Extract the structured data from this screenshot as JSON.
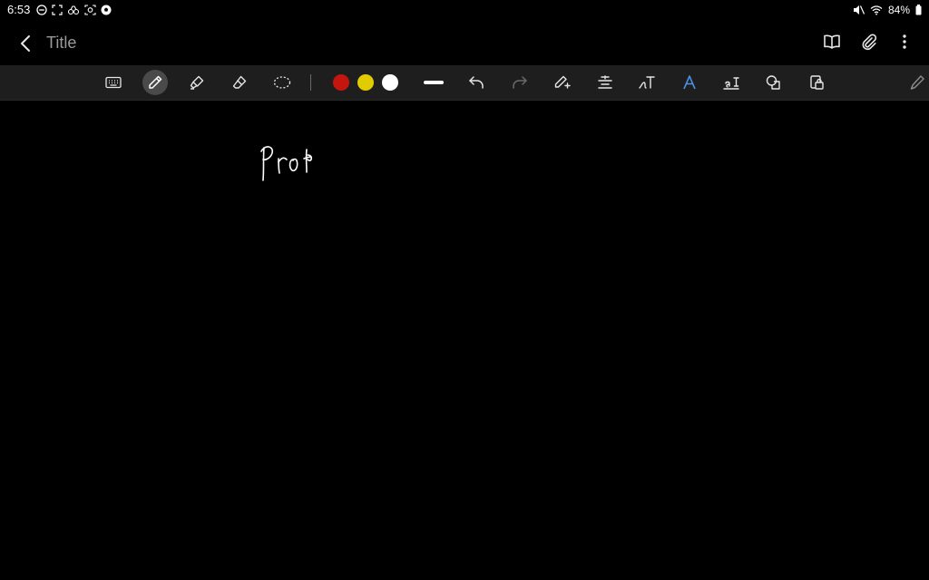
{
  "status_bar": {
    "time": "6:53",
    "battery": "84%"
  },
  "title_bar": {
    "title": "Title"
  },
  "toolbar": {
    "tools": [
      "keyboard-icon",
      "pen-icon",
      "highlighter-icon",
      "eraser-icon",
      "lasso-icon",
      "stroke-width-icon",
      "undo-icon",
      "redo-icon",
      "pen-settings-icon",
      "text-align-icon",
      "handwriting-to-text-icon",
      "text-style-icon",
      "text-box-icon",
      "shapes-icon",
      "lock-icon",
      "edit-pencil-icon"
    ],
    "active_tool": "pen-icon",
    "colors": {
      "red": "#c4160f",
      "yellow": "#e0cc00",
      "white": "#ffffff"
    }
  },
  "canvas": {
    "background": "#000000",
    "ink_color": "#ffffff"
  }
}
